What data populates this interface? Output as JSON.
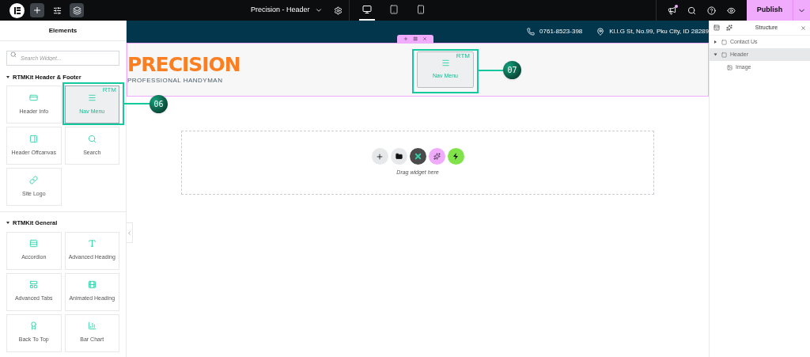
{
  "topbar": {
    "title": "Precision - Header",
    "devices": [
      {
        "kind": "desktop",
        "selected": true
      },
      {
        "kind": "tablet",
        "selected": false
      },
      {
        "kind": "mobile",
        "selected": false
      }
    ],
    "notification": true,
    "publish": "Publish"
  },
  "elements_panel": {
    "title": "Elements",
    "search": {
      "placeholder": "Search Widget..."
    },
    "categories": [
      {
        "name": "RTMKit Header & Footer",
        "expanded": true,
        "widgets": [
          {
            "label": "Header Info",
            "selected": false
          },
          {
            "label": "Nav Menu",
            "selected": true,
            "badge": "RTM"
          },
          {
            "label": "Header Offcanvas",
            "selected": false
          },
          {
            "label": "Search",
            "selected": false
          },
          {
            "label": "Site Logo",
            "selected": false
          }
        ]
      },
      {
        "name": "RTMKit General",
        "expanded": true,
        "widgets": [
          {
            "label": "Accordion",
            "selected": false
          },
          {
            "label": "Advanced Heading",
            "selected": false
          },
          {
            "label": "Advanced Tabs",
            "selected": false
          },
          {
            "label": "Animated Heading",
            "selected": false
          },
          {
            "label": "Back To Top",
            "selected": false
          },
          {
            "label": "Bar Chart",
            "selected": false
          }
        ]
      }
    ]
  },
  "canvas": {
    "contact_bar": {
      "phone": "0761-8523-398",
      "address": "Kl.l.G St, No.99, Pku City, ID 28289"
    },
    "logo": {
      "name": "PRECISION",
      "tagline": "PROFESSIONAL HANDYMAN"
    },
    "nav_widget": {
      "label": "Nav Menu",
      "badge": "RTM"
    },
    "dropzone": {
      "text": "Drag widget here"
    },
    "callouts": [
      {
        "number": "06"
      },
      {
        "number": "07"
      }
    ]
  },
  "structure": {
    "title": "Structure",
    "items": [
      {
        "label": "Contact Us",
        "expanded": false,
        "selected": false
      },
      {
        "label": "Header",
        "expanded": true,
        "selected": true,
        "children": [
          {
            "label": "Image",
            "selected": false
          }
        ]
      }
    ]
  }
}
